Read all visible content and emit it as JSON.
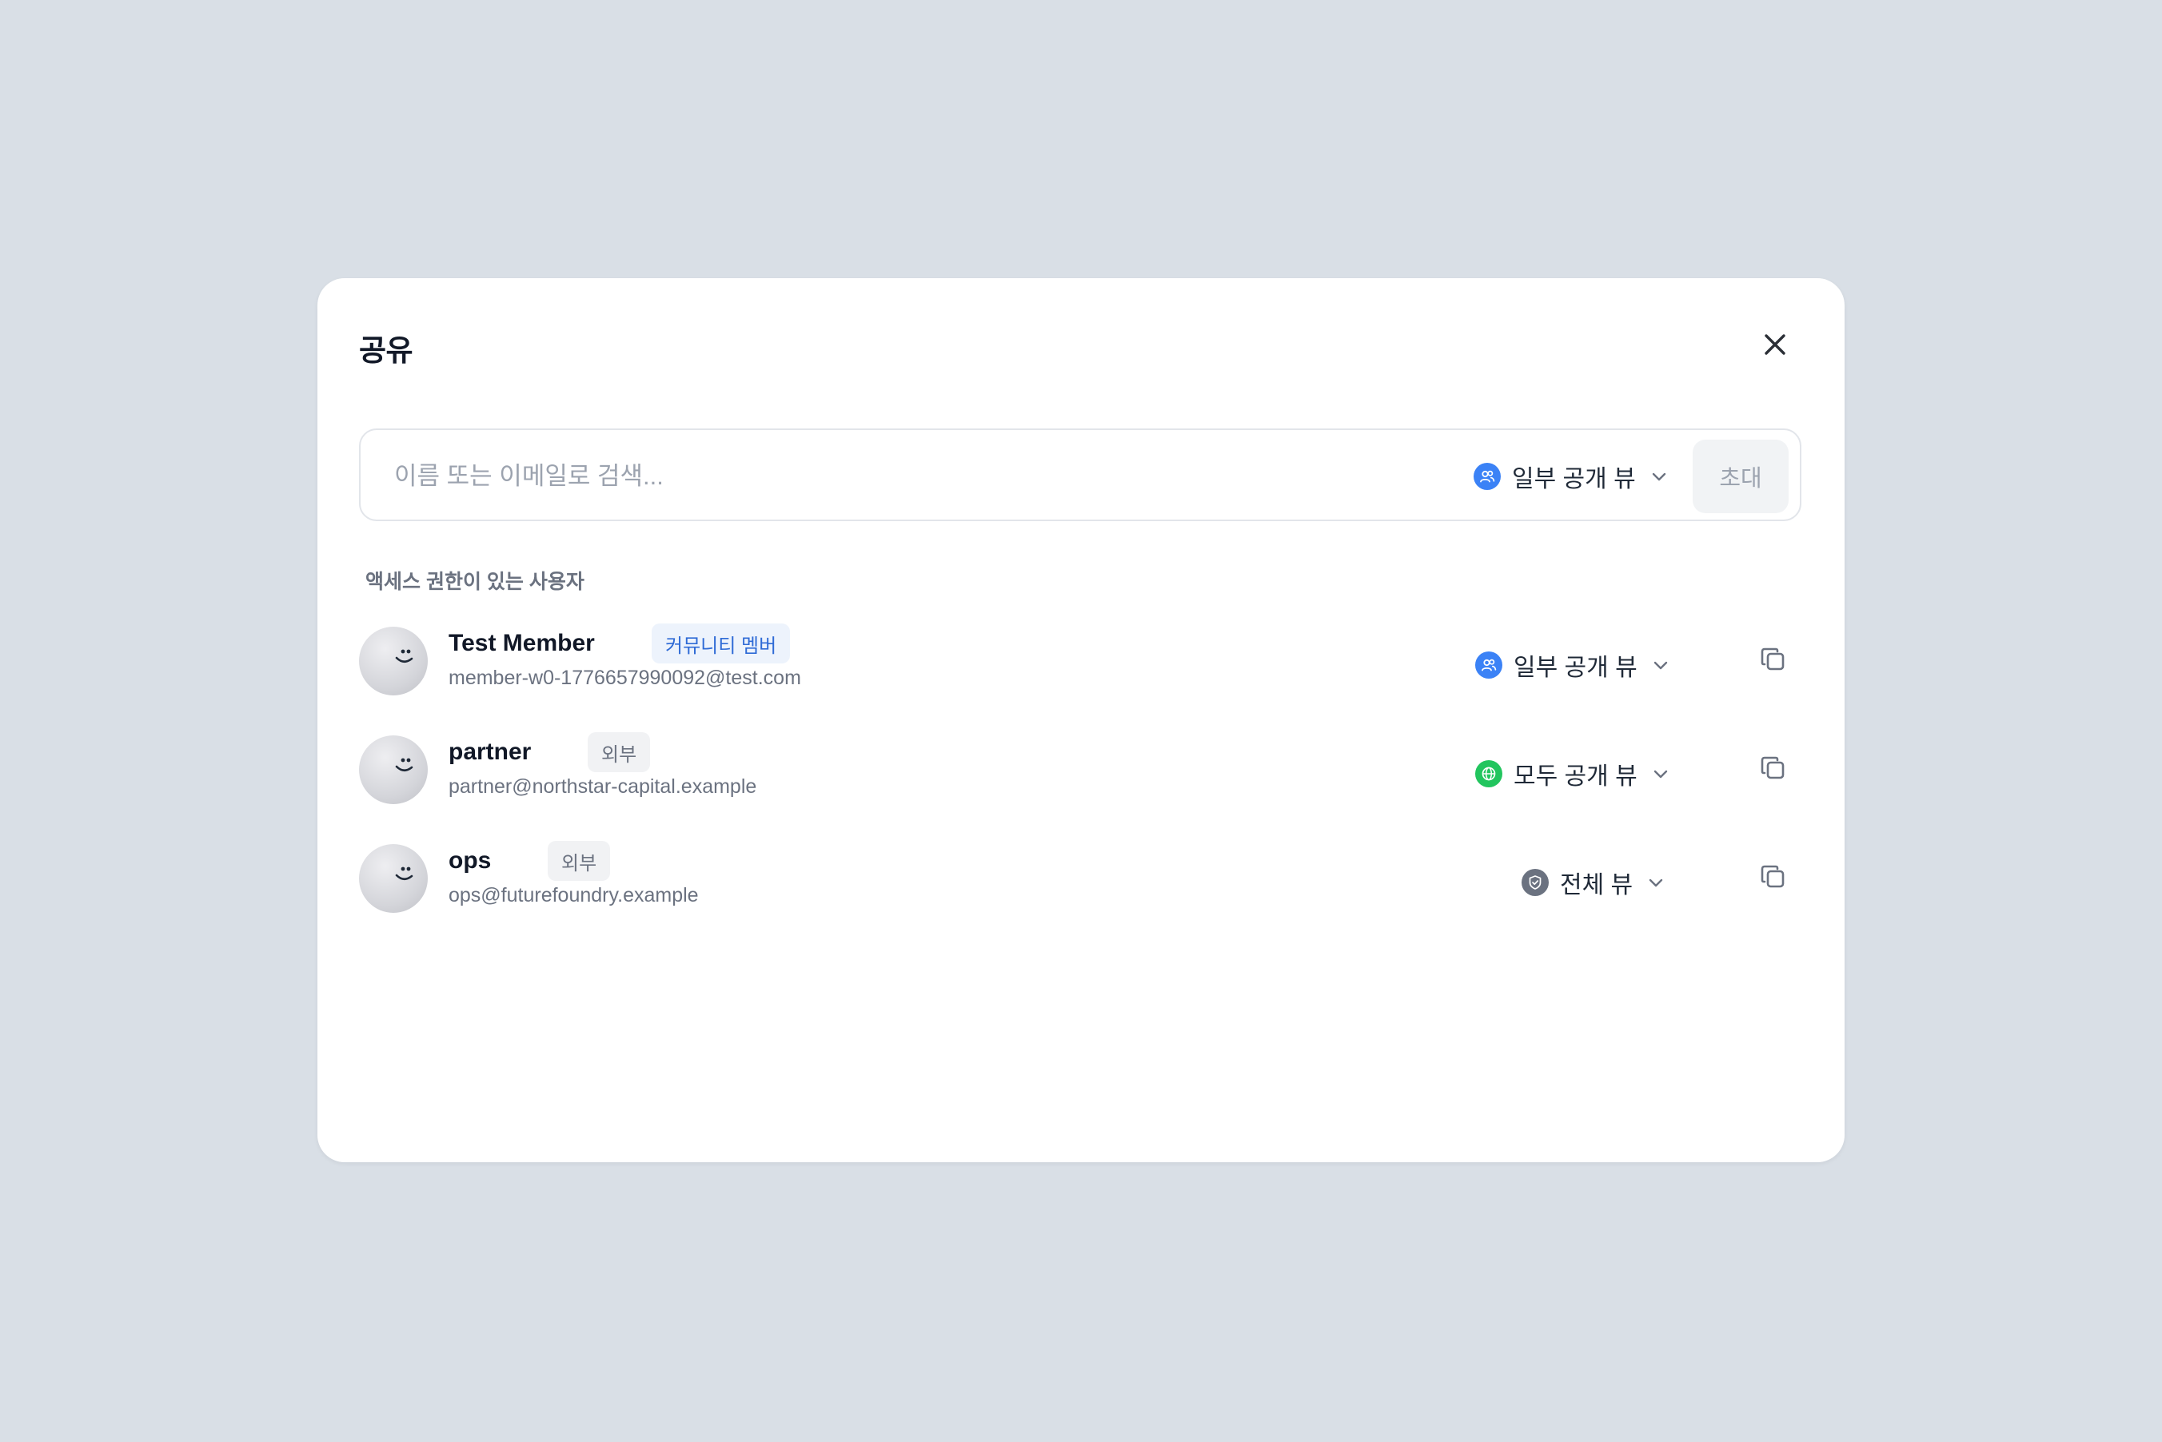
{
  "dialog": {
    "title": "공유",
    "close_icon": "close-icon"
  },
  "search": {
    "placeholder": "이름 또는 이메일로 검색...",
    "permission_label": "일부 공개 뷰",
    "permission_icon": "users-icon",
    "invite_label": "초대"
  },
  "access_section": {
    "label": "액세스 권한이 있는 사용자",
    "users": [
      {
        "name": "Test Member",
        "badge": "커뮤니티 멤버",
        "email": "member-w0-1776657990092@test.com",
        "permission": "일부 공개 뷰",
        "permission_icon": "users-icon"
      },
      {
        "name": "partner",
        "badge": "외부",
        "email": "partner@northstar-capital.example",
        "permission": "모두 공개 뷰",
        "permission_icon": "globe-icon"
      },
      {
        "name": "ops",
        "badge": "외부",
        "email": "ops@futurefoundry.example",
        "permission": "전체 뷰",
        "permission_icon": "shield-icon"
      }
    ]
  },
  "colors": {
    "background": "#d9dfe6",
    "accent_blue": "#3b82f6",
    "globe_green": "#22c55e",
    "shield_gray": "#6b7280",
    "member_badge_text": "#2f6bd6"
  }
}
